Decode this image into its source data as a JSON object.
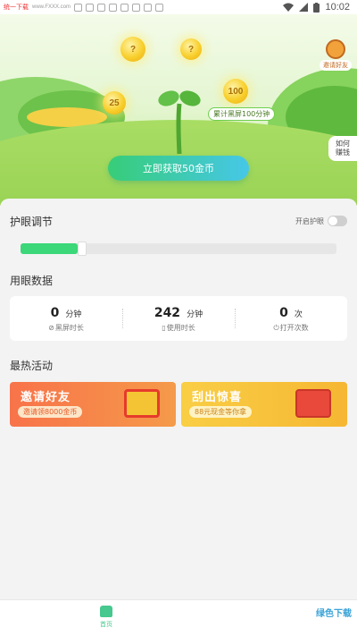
{
  "status_bar": {
    "brand": "统一下载",
    "url": "www.FXXX.com",
    "time": "10:02",
    "icons": [
      "wifi-icon",
      "signal-icon",
      "battery-icon"
    ]
  },
  "hero": {
    "coins": [
      "?",
      "?",
      "25",
      "100"
    ],
    "accumulate_label": "累计黑屏100分钟",
    "invite_corner": "邀请好友",
    "how_to_earn": [
      "如何",
      "赚钱"
    ],
    "get_coins_button": "立即获取50金币"
  },
  "eye_care": {
    "title": "护眼调节",
    "toggle_label": "开启护眼",
    "toggle_on": false,
    "brightness_level": 0.18
  },
  "usage_data": {
    "title": "用眼数据",
    "stats": [
      {
        "value": "0",
        "unit": "分钟",
        "label": "黑屏时长",
        "icon": "moon-icon"
      },
      {
        "value": "242",
        "unit": "分钟",
        "label": "使用时长",
        "icon": "phone-icon"
      },
      {
        "value": "0",
        "unit": "次",
        "label": "打开次数",
        "icon": "power-icon"
      }
    ]
  },
  "hot_activities": {
    "title": "最热活动",
    "items": [
      {
        "title": "邀请好友",
        "subtitle": "邀请领8000金币",
        "color": "#f66a3b"
      },
      {
        "title": "刮出惊喜",
        "subtitle": "88元现金等你拿",
        "color": "#f7c23a"
      }
    ]
  },
  "bottom_nav": {
    "home_label": "首页",
    "watermark": "绿色下载"
  },
  "colors": {
    "accent_green": "#3bd778",
    "button_gradient_start": "#37cd78",
    "button_gradient_end": "#46c7e8"
  }
}
